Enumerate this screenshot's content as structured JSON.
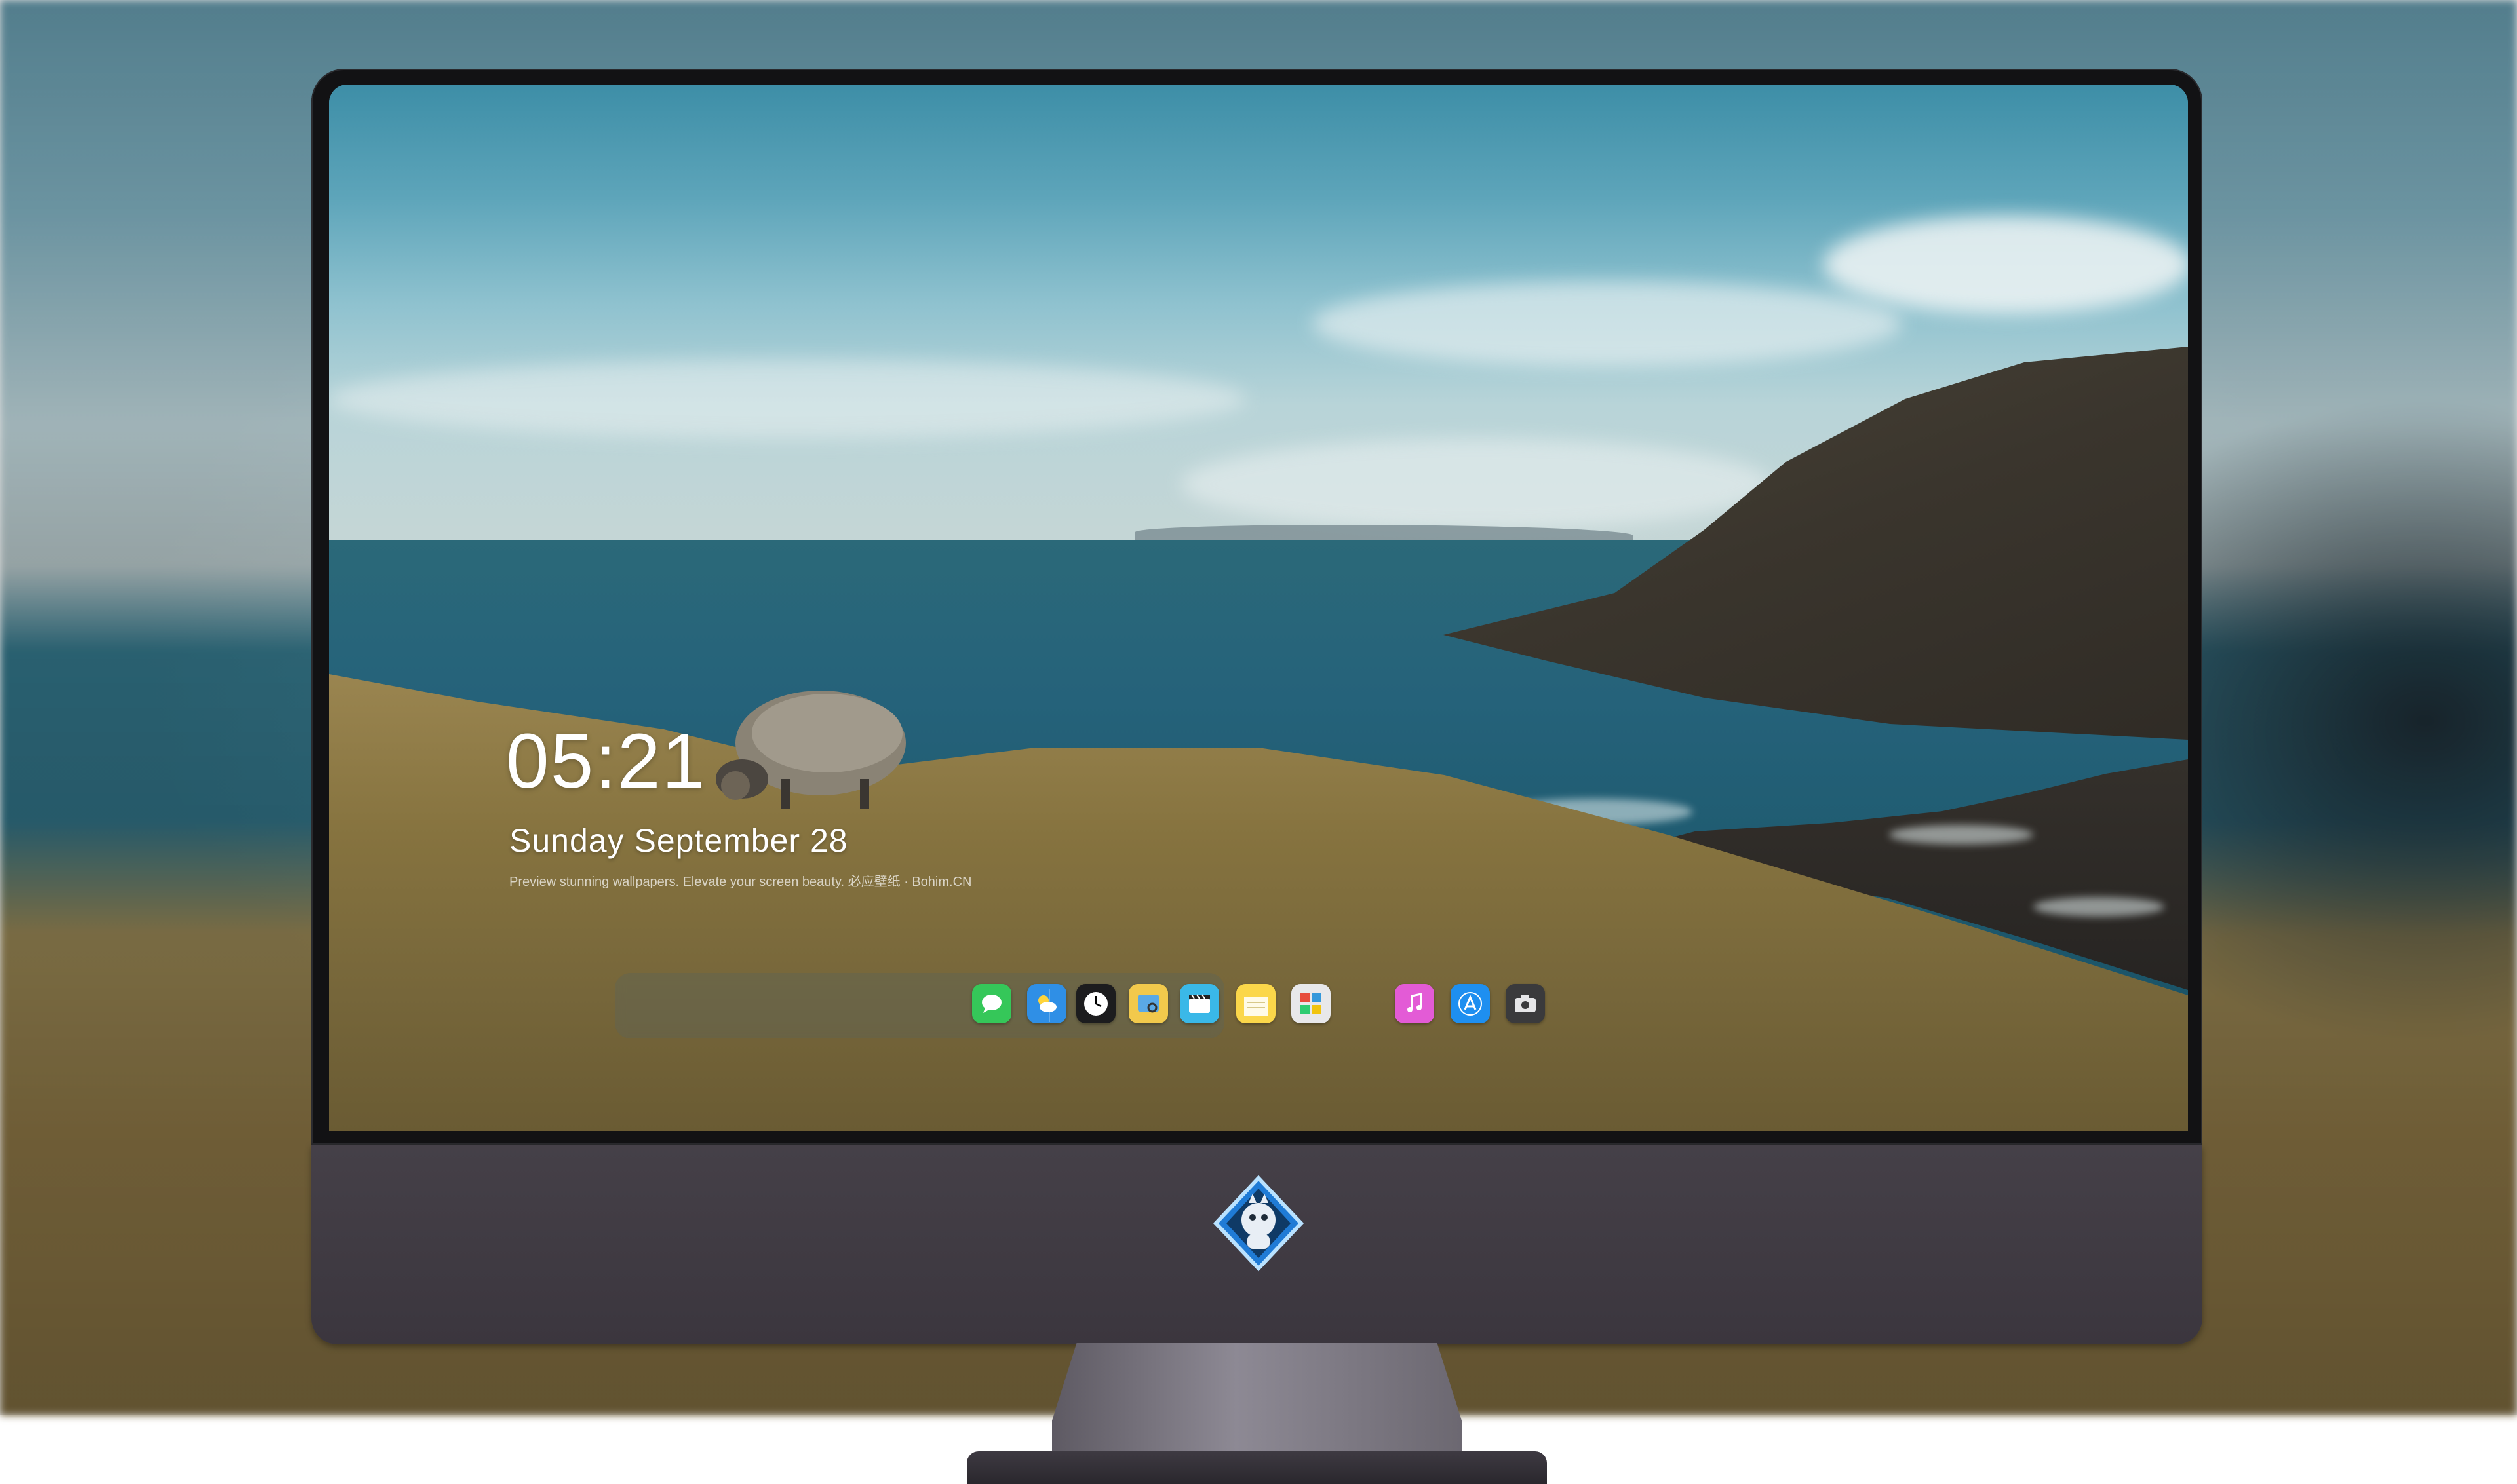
{
  "lock_screen": {
    "time": "05:21",
    "date": "Sunday September  28",
    "tagline": "Preview stunning wallpapers. Elevate your screen beauty. 必应壁纸 · Bohim.CN"
  },
  "dock": {
    "apps": [
      {
        "name": "Messages",
        "icon": "messages-icon",
        "color": "#35c759"
      },
      {
        "name": "Weather",
        "icon": "weather-icon",
        "color": "#2f8fe6"
      },
      {
        "name": "Clock",
        "icon": "clock-icon",
        "color": "#1c1c1e"
      },
      {
        "name": "Preview",
        "icon": "preview-icon",
        "color": "#f2c94c"
      },
      {
        "name": "Clips",
        "icon": "clips-icon",
        "color": "#3ab8e8"
      },
      {
        "name": "Notes",
        "icon": "notes-icon",
        "color": "#fbd74a"
      },
      {
        "name": "Photo Booth",
        "icon": "photo-booth-icon",
        "color": "#e8e8ea"
      },
      {
        "name": "Music",
        "icon": "music-icon",
        "color": "#e35bd6"
      },
      {
        "name": "App Store",
        "icon": "app-store-icon",
        "color": "#1e8ff0"
      },
      {
        "name": "Screenshot",
        "icon": "camera-icon",
        "color": "#3a3a3c"
      }
    ]
  },
  "colors": {
    "bezel": "#121214",
    "chin": "#3f3a42",
    "sea": "#25627a",
    "grass": "#86733f"
  }
}
